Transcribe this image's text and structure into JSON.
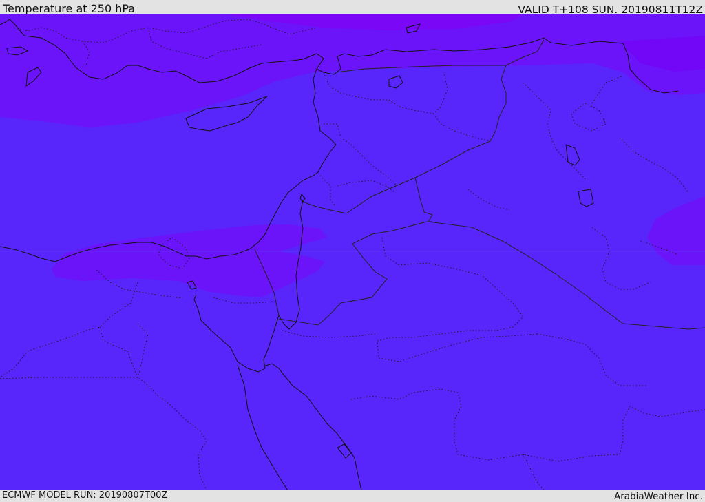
{
  "header": {
    "title": "Temperature at 250 hPa",
    "valid_time": "VALID T+108 SUN. 20190811T12Z"
  },
  "footer": {
    "model_run": "ECMWF MODEL RUN: 20190807T00Z",
    "credit": "ArabiaWeather Inc."
  },
  "colors": {
    "base_fill": "#5826fb",
    "warm_band_fill": "#6b14f9",
    "warmest_band_fill": "#7a07f5",
    "coastline": "#111111",
    "border": "#222222"
  },
  "map": {
    "field": "temperature",
    "level": "250 hPa",
    "layers": [
      "coastlines",
      "international-borders",
      "internal-boundaries",
      "temperature-shading"
    ]
  }
}
